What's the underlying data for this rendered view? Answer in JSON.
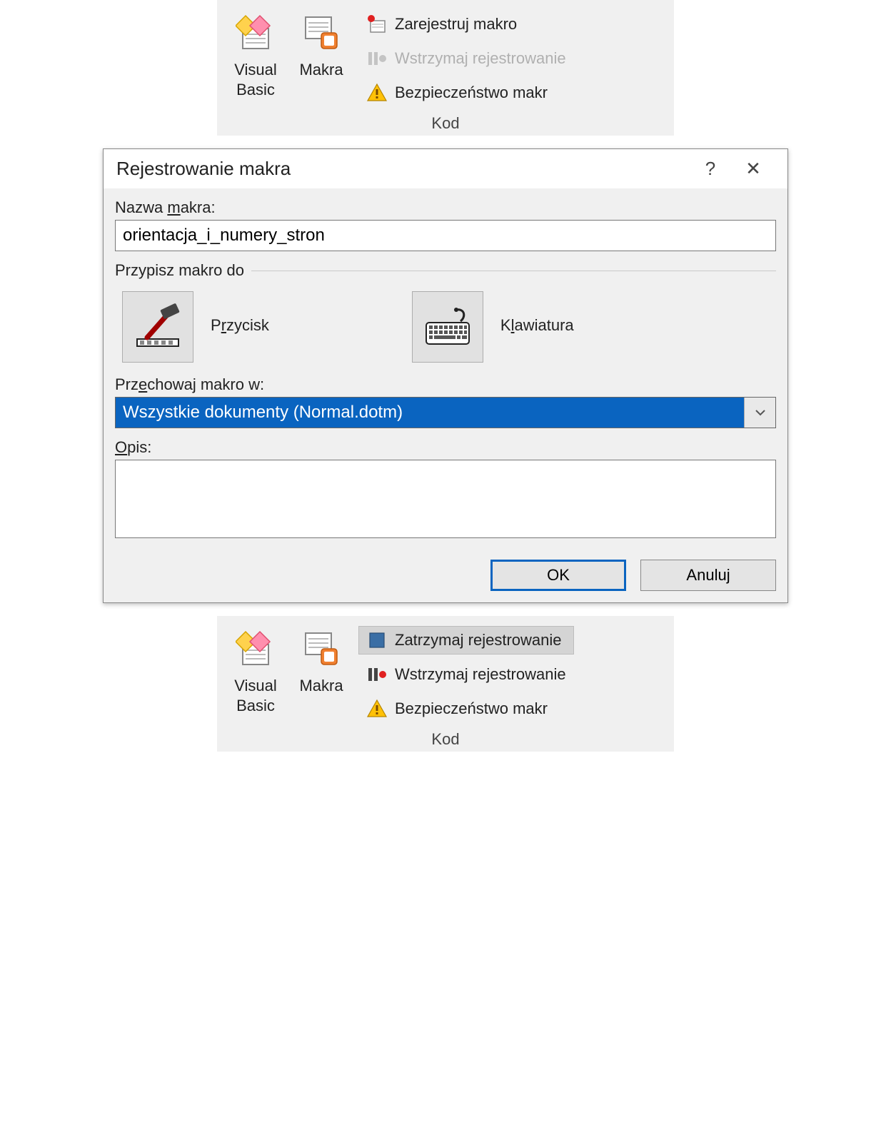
{
  "ribbon1": {
    "visual_basic": "Visual\nBasic",
    "makra": "Makra",
    "record": "Zarejestruj makro",
    "pause": "Wstrzymaj rejestrowanie",
    "security": "Bezpieczeństwo makr",
    "group": "Kod"
  },
  "dialog": {
    "title": "Rejestrowanie makra",
    "help": "?",
    "close": "✕",
    "name_label_pre": "Nazwa ",
    "name_label_mn": "m",
    "name_label_post": "akra:",
    "name_value": "orientacja_i_numery_stron",
    "assign_label": "Przypisz makro do",
    "btn_pre": "P",
    "btn_mn": "r",
    "btn_post": "zycisk",
    "kbd_pre": "K",
    "kbd_mn": "l",
    "kbd_post": "awiatura",
    "store_label_pre": "Prz",
    "store_label_mn": "e",
    "store_label_post": "chowaj makro w:",
    "store_value": "Wszystkie dokumenty (Normal.dotm)",
    "desc_label_pre": "",
    "desc_label_mn": "O",
    "desc_label_post": "pis:",
    "desc_value": "",
    "ok": "OK",
    "cancel": "Anuluj"
  },
  "ribbon2": {
    "visual_basic": "Visual\nBasic",
    "makra": "Makra",
    "stop": "Zatrzymaj rejestrowanie",
    "pause": "Wstrzymaj rejestrowanie",
    "security": "Bezpieczeństwo makr",
    "group": "Kod"
  }
}
